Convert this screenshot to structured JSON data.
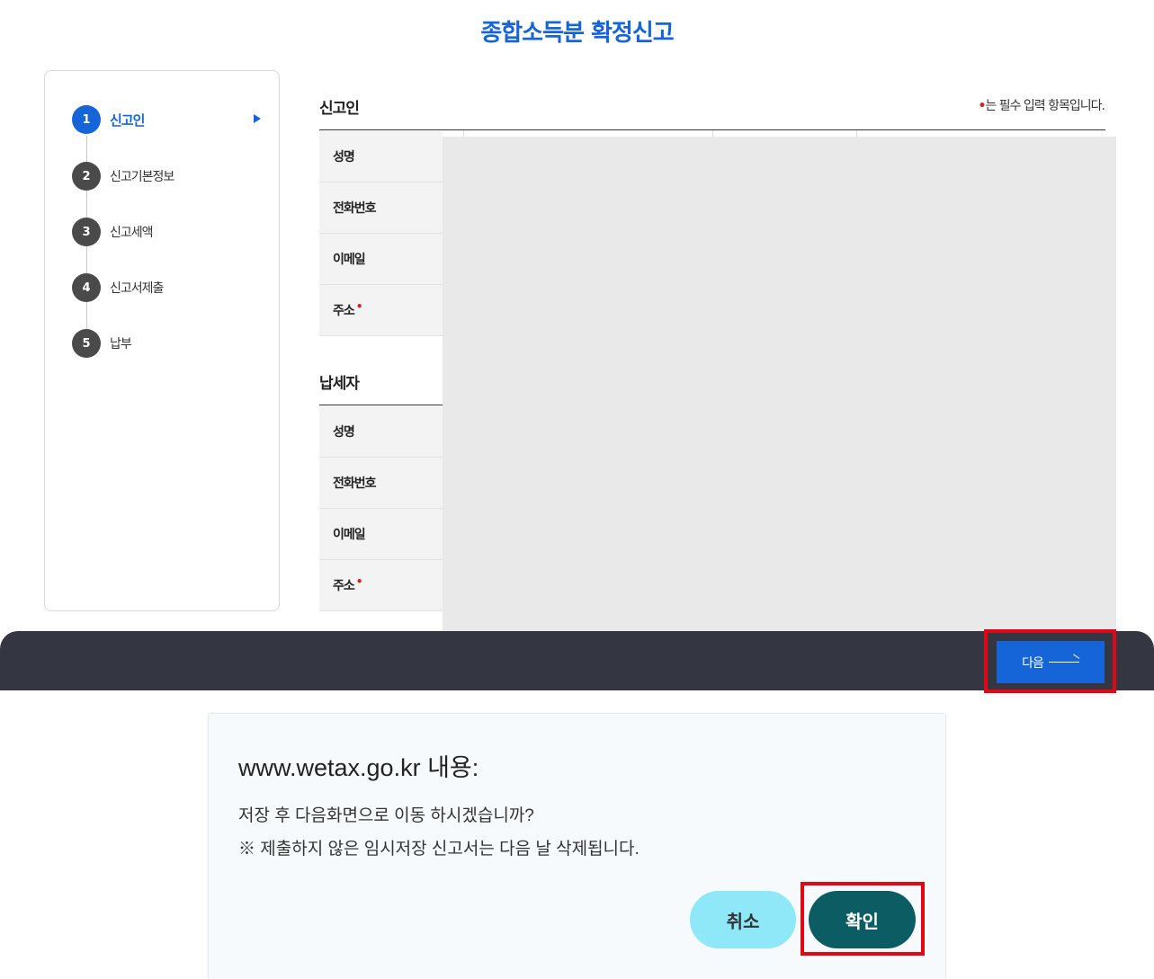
{
  "page": {
    "title": "종합소득분 확정신고"
  },
  "steps": [
    {
      "num": "1",
      "label": "신고인",
      "active": true
    },
    {
      "num": "2",
      "label": "신고기본정보"
    },
    {
      "num": "3",
      "label": "신고세액"
    },
    {
      "num": "4",
      "label": "신고서제출"
    },
    {
      "num": "5",
      "label": "납부"
    }
  ],
  "required_note": {
    "dot": "•",
    "text": "는 필수 입력 항목입니다."
  },
  "reporter": {
    "title": "신고인",
    "fields": [
      {
        "label": "성명"
      },
      {
        "label": "전화번호"
      },
      {
        "label": "이메일"
      },
      {
        "label": "주소",
        "required": "•"
      }
    ]
  },
  "taxpayer": {
    "title": "납세자",
    "fields": [
      {
        "label": "성명"
      },
      {
        "label": "전화번호"
      },
      {
        "label": "이메일"
      },
      {
        "label": "주소",
        "required": "•"
      }
    ]
  },
  "footer": {
    "next_label": "다음"
  },
  "dialog": {
    "title": "www.wetax.go.kr 내용:",
    "message_line1": "저장 후 다음화면으로 이동 하시겠습니까?",
    "message_line2": "※ 제출하지 않은 임시저장 신고서는 다음 날 삭제됩니다.",
    "cancel_label": "취소",
    "ok_label": "확인"
  },
  "colors": {
    "accent": "#1565d8",
    "footer_bar": "#343642",
    "highlight": "#e30613",
    "cancel_btn": "#8ee8f7",
    "ok_btn": "#0c5c64"
  }
}
